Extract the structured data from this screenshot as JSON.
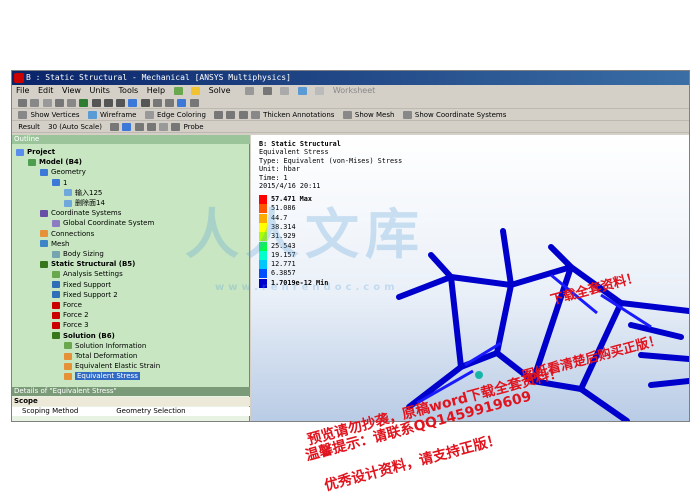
{
  "window": {
    "title": "B : Static Structural - Mechanical [ANSYS Multiphysics]"
  },
  "menu": [
    "File",
    "Edit",
    "View",
    "Units",
    "Tools",
    "Help"
  ],
  "toolbar1": {
    "solve": "Solve",
    "worksheet": "Worksheet"
  },
  "toolbar3": {
    "show_vertices": "Show Vertices",
    "wireframe": "Wireframe",
    "edge_coloring": "Edge Coloring",
    "thicken_annotations": "Thicken Annotations",
    "show_mesh": "Show Mesh",
    "show_coord": "Show Coordinate Systems"
  },
  "toolbar4": {
    "result_label": "Result",
    "scale_value": "30 (Auto Scale)",
    "probe": "Probe"
  },
  "outline": {
    "header": "Outline",
    "items": [
      {
        "label": "Project",
        "bold": true,
        "indent": 0,
        "icon": "project-icon"
      },
      {
        "label": "Model (B4)",
        "bold": true,
        "indent": 1,
        "icon": "model-icon"
      },
      {
        "label": "Geometry",
        "bold": false,
        "indent": 2,
        "icon": "geometry-icon"
      },
      {
        "label": "1",
        "bold": false,
        "indent": 3,
        "icon": "part-icon"
      },
      {
        "label": "输入125",
        "bold": false,
        "indent": 4,
        "icon": "body-icon"
      },
      {
        "label": "删除面14",
        "bold": false,
        "indent": 4,
        "icon": "body-icon"
      },
      {
        "label": "Coordinate Systems",
        "bold": false,
        "indent": 2,
        "icon": "coordinate-icon"
      },
      {
        "label": "Global Coordinate System",
        "bold": false,
        "indent": 3,
        "icon": "axis-icon"
      },
      {
        "label": "Connections",
        "bold": false,
        "indent": 2,
        "icon": "connections-icon"
      },
      {
        "label": "Mesh",
        "bold": false,
        "indent": 2,
        "icon": "mesh-icon"
      },
      {
        "label": "Body Sizing",
        "bold": false,
        "indent": 3,
        "icon": "sizing-icon"
      },
      {
        "label": "Static Structural (B5)",
        "bold": true,
        "indent": 2,
        "icon": "analysis-icon"
      },
      {
        "label": "Analysis Settings",
        "bold": false,
        "indent": 3,
        "icon": "settings-icon"
      },
      {
        "label": "Fixed Support",
        "bold": false,
        "indent": 3,
        "icon": "support-icon"
      },
      {
        "label": "Fixed Support 2",
        "bold": false,
        "indent": 3,
        "icon": "support-icon"
      },
      {
        "label": "Force",
        "bold": false,
        "indent": 3,
        "icon": "force-icon"
      },
      {
        "label": "Force 2",
        "bold": false,
        "indent": 3,
        "icon": "force-icon"
      },
      {
        "label": "Force 3",
        "bold": false,
        "indent": 3,
        "icon": "force-icon"
      },
      {
        "label": "Solution (B6)",
        "bold": true,
        "indent": 3,
        "icon": "solution-icon"
      },
      {
        "label": "Solution Information",
        "bold": false,
        "indent": 4,
        "icon": "info-icon"
      },
      {
        "label": "Total Deformation",
        "bold": false,
        "indent": 4,
        "icon": "result-icon"
      },
      {
        "label": "Equivalent Elastic Strain",
        "bold": false,
        "indent": 4,
        "icon": "result-icon"
      },
      {
        "label": "Equivalent Stress",
        "bold": false,
        "indent": 4,
        "icon": "result-icon",
        "selected": true
      }
    ]
  },
  "details": {
    "header": "Details of \"Equivalent Stress\"",
    "scope": "Scope",
    "row_label": "Scoping Method",
    "row_value": "Geometry Selection"
  },
  "viewport": {
    "info": [
      "B: Static Structural",
      "Equivalent Stress",
      "Type: Equivalent (von-Mises) Stress",
      "Unit: hbar",
      "Time: 1",
      "2015/4/16 20:11"
    ],
    "legend": [
      {
        "value": "57.471 Max",
        "color": "#ff0000",
        "bold": true
      },
      {
        "value": "51.086",
        "color": "#ff5500"
      },
      {
        "value": "44.7",
        "color": "#ffaa00"
      },
      {
        "value": "38.314",
        "color": "#ffff00"
      },
      {
        "value": "31.929",
        "color": "#aaff00"
      },
      {
        "value": "25.543",
        "color": "#00ff44"
      },
      {
        "value": "19.157",
        "color": "#00ffcc"
      },
      {
        "value": "12.771",
        "color": "#00c8ff"
      },
      {
        "value": "6.3857",
        "color": "#0050ff"
      },
      {
        "value": "1.7019e-12 Min",
        "color": "#0000cc",
        "bold": true
      }
    ]
  },
  "watermark": {
    "main": "人人文库",
    "url": "www.renrendoc.com"
  },
  "overlay": [
    "预览请勿抄袭，原稿word下载全套资料！",
    "温馨提示：请联系QQ1459919609",
    "优秀设计资料，请支持正版！",
    "下载全套资料！",
    "图纸看清楚后购买正版！"
  ]
}
